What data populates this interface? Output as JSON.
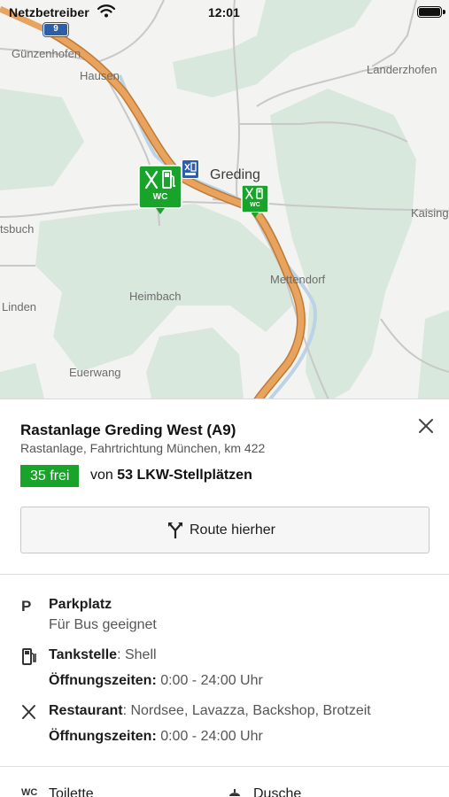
{
  "status_bar": {
    "carrier": "Netzbetreiber",
    "time": "12:01"
  },
  "map": {
    "highway_shield": "9",
    "places": {
      "gunzenhofen": "Günzenhofen",
      "hausen": "Hausen",
      "landerzhofen": "Landerzhofen",
      "greding": "Greding",
      "kaising": "Kaising",
      "tsbuch": "tsbuch",
      "mettendorf": "Mettendorf",
      "heimbach": "Heimbach",
      "linden": "Linden",
      "euerwang": "Euerwang"
    },
    "marker_west_label": "WC",
    "marker_east_label": "WC",
    "colors": {
      "motorway": "#e8a35e",
      "forest": "#d9e8dd",
      "river": "#bcd3e6",
      "marker": "#18a32a"
    }
  },
  "sheet": {
    "title": "Rastanlage Greding West (A9)",
    "subtitle": "Rastanlage, Fahrtrichtung München, km 422",
    "free_badge": "35 frei",
    "free_of": "von",
    "free_total": "53 LKW-Stellplätzen",
    "route_button": "Route hierher",
    "parking": {
      "icon": "P",
      "title": "Parkplatz",
      "subtitle": "Für Bus geeignet"
    },
    "fuel": {
      "title": "Tankstelle",
      "value": ": Shell",
      "hours_label": "Öffnungszeiten:",
      "hours_value": " 0:00 - 24:00 Uhr"
    },
    "restaurant": {
      "title": "Restaurant",
      "value": ": Nordsee, Lavazza, Backshop, Brotzeit",
      "hours_label": "Öffnungszeiten:",
      "hours_value": " 0:00 - 24:00 Uhr"
    },
    "amenities": {
      "toilet": "Toilette",
      "shower": "Dusche"
    }
  }
}
